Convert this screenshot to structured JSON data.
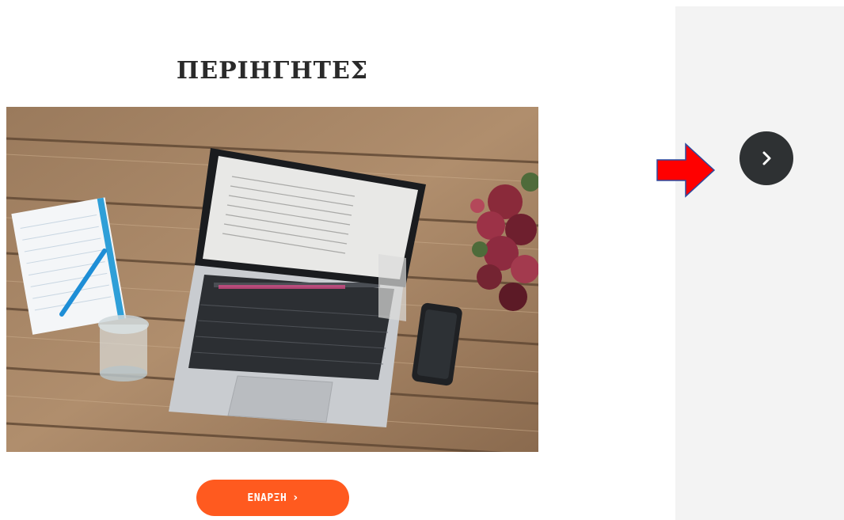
{
  "main": {
    "title": "ΠΕΡΙΗΓΗΤΕΣ",
    "start_button_label": "ΕΝΑΡΞΗ",
    "start_button_icon": "chevron-right-icon",
    "hero_image": "laptop-on-wooden-desk"
  },
  "sidebar": {
    "next_button_icon": "chevron-right-icon"
  },
  "annotation": {
    "arrow_icon": "red-arrow-icon",
    "arrow_color": "#ff0000"
  },
  "colors": {
    "accent": "#ff5a1f",
    "next_button": "#2e3133",
    "side_panel": "#f3f3f3"
  }
}
